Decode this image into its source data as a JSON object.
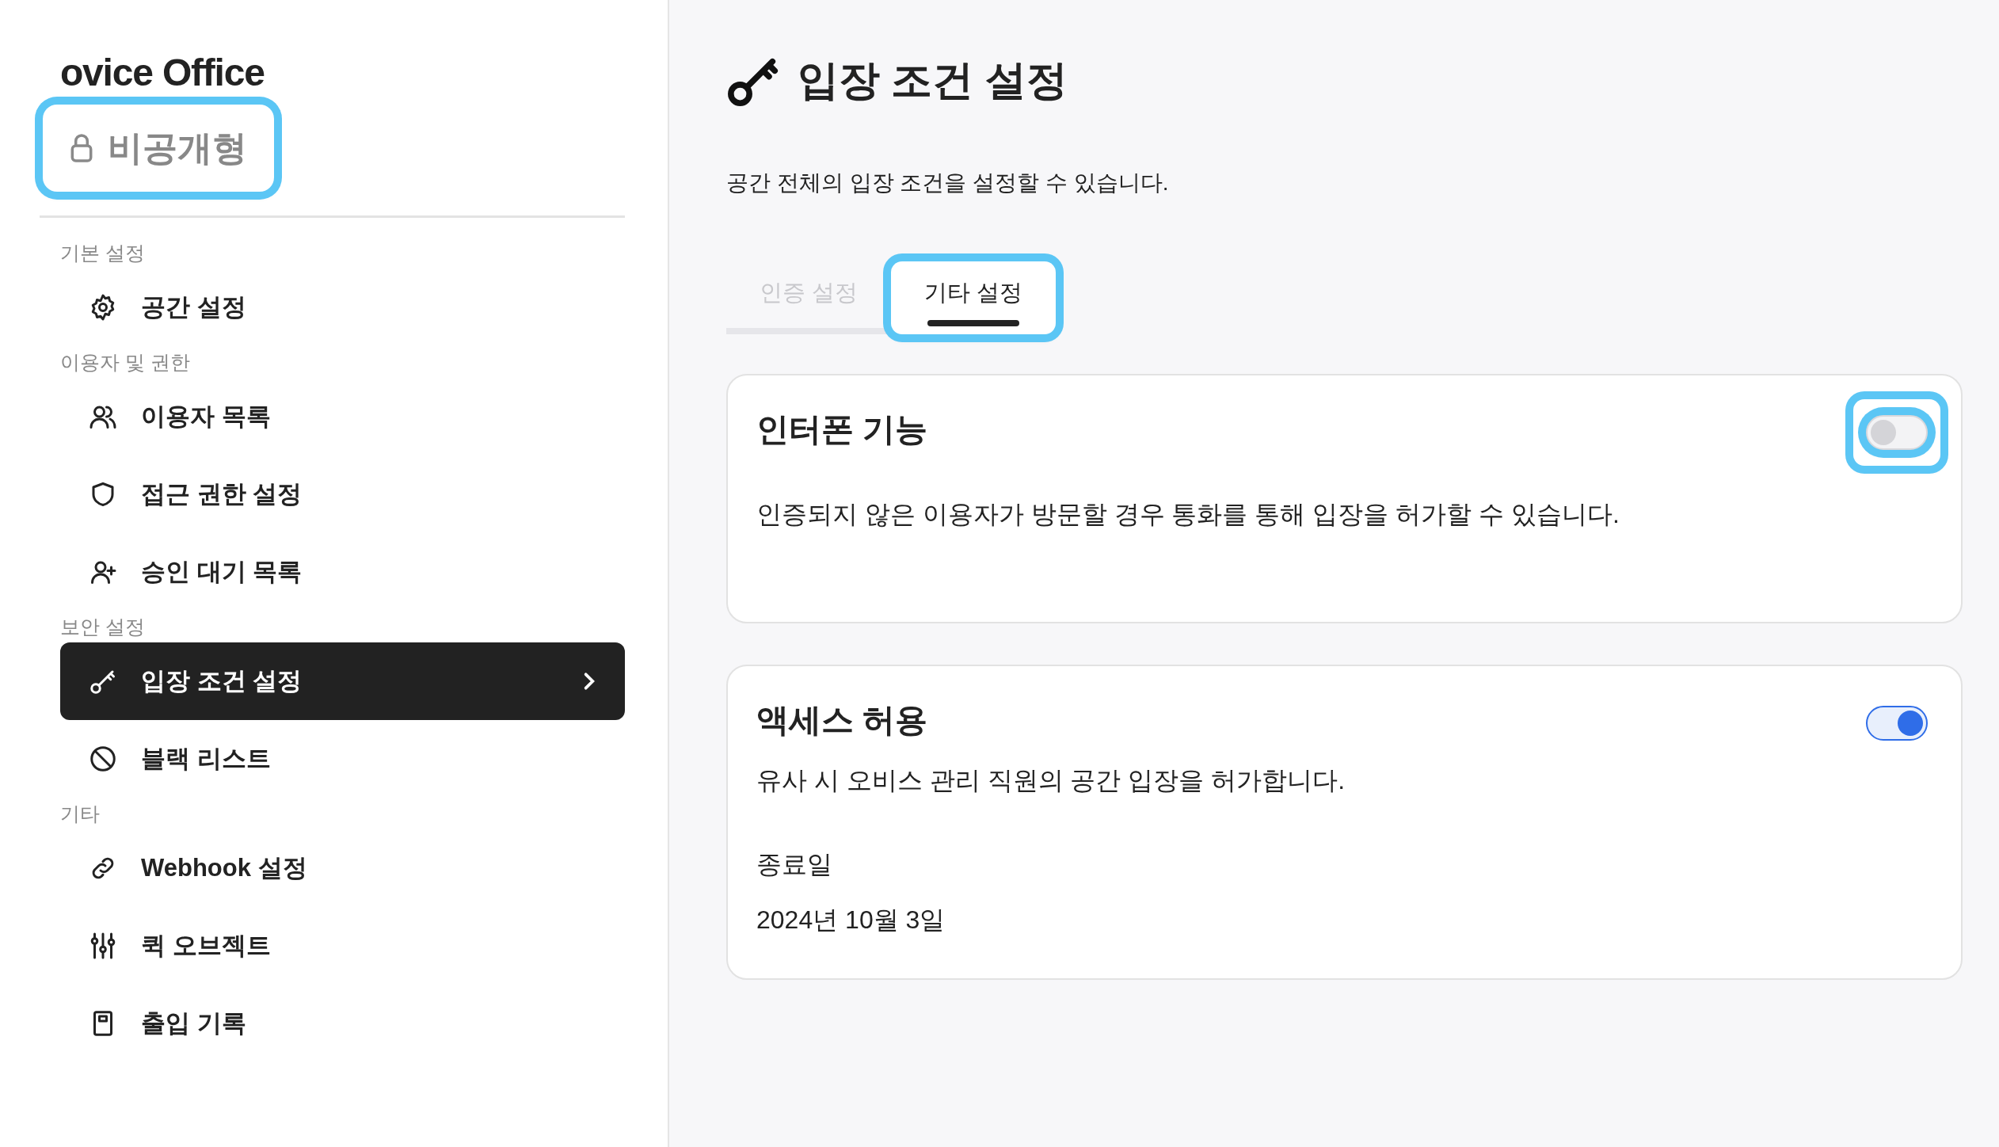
{
  "sidebar": {
    "title": "ovice Office",
    "badge": {
      "label": "비공개형",
      "highlighted": true
    },
    "sections": [
      {
        "label": "기본 설정",
        "items": [
          {
            "label": "공간 설정",
            "selected": false
          }
        ]
      },
      {
        "label": "이용자 및 권한",
        "items": [
          {
            "label": "이용자 목록",
            "selected": false
          },
          {
            "label": "접근 권한 설정",
            "selected": false
          },
          {
            "label": "승인 대기 목록",
            "selected": false
          }
        ]
      },
      {
        "label": "보안 설정",
        "items": [
          {
            "label": "입장 조건 설정",
            "selected": true
          },
          {
            "label": "블랙 리스트",
            "selected": false
          }
        ]
      },
      {
        "label": "기타",
        "items": [
          {
            "label": "Webhook 설정",
            "selected": false
          },
          {
            "label": "퀵 오브젝트",
            "selected": false
          },
          {
            "label": "출입 기록",
            "selected": false
          }
        ]
      }
    ]
  },
  "main": {
    "title": "입장 조건 설정",
    "description": "공간 전체의 입장 조건을 설정할 수 있습니다.",
    "tabs": [
      {
        "label": "인증 설정",
        "selected": false,
        "highlighted": false
      },
      {
        "label": "기타 설정",
        "selected": true,
        "highlighted": true
      }
    ],
    "cards": [
      {
        "title": "인터폰 기능",
        "description": "인증되지 않은 이용자가 방문할 경우 통화를 통해 입장을 허가할 수 있습니다.",
        "toggle": {
          "on": false,
          "highlighted": true
        }
      },
      {
        "title": "액세스 허용",
        "description": "유사 시 오비스 관리 직원의 공간 입장을 허가합니다.",
        "toggle": {
          "on": true,
          "highlighted": false
        },
        "end_date_label": "종료일",
        "end_date": "2024년 10월 3일"
      }
    ]
  }
}
